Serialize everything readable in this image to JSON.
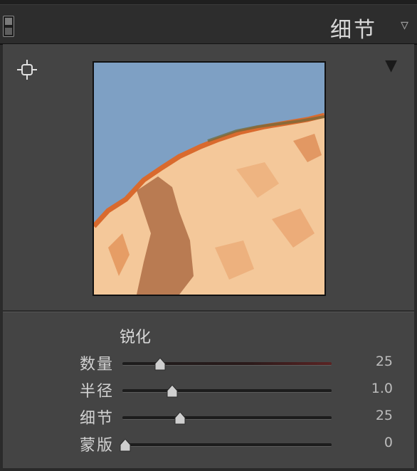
{
  "header": {
    "title": "细节",
    "collapse_icon": "double-chevron-down-icon",
    "toggle_icon": "panel-switch-icon"
  },
  "preview": {
    "target_icon": "crosshair-target-icon",
    "menu_icon": "triangle-down-icon"
  },
  "sharpening": {
    "title": "锐化",
    "sliders": [
      {
        "label": "数量",
        "value": "25",
        "position": 0.17
      },
      {
        "label": "半径",
        "value": "1.0",
        "position": 0.23
      },
      {
        "label": "细节",
        "value": "25",
        "position": 0.27
      },
      {
        "label": "蒙版",
        "value": "0",
        "position": 0.0
      }
    ]
  },
  "colors": {
    "panel_bg": "#444444",
    "header_bg": "#2d2d2d",
    "sky": "#7ea0c4",
    "rock": "#f4c89a"
  }
}
